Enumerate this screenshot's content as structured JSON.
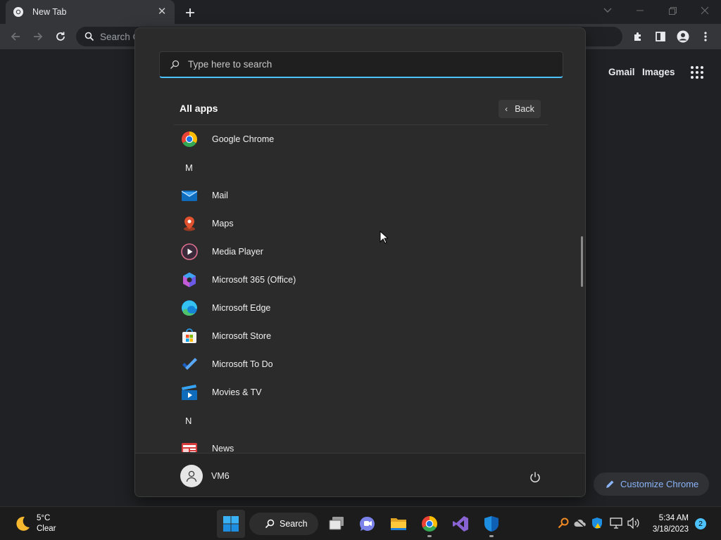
{
  "browser": {
    "tab_title": "New Tab",
    "omnibox_placeholder": "Search Google or type a URL",
    "omnibox_visible_text": "Search G",
    "links": {
      "gmail": "Gmail",
      "images": "Images"
    },
    "customize_label": "Customize Chrome"
  },
  "start_menu": {
    "search_placeholder": "Type here to search",
    "all_apps_title": "All apps",
    "back_label": "Back",
    "items": [
      {
        "kind": "app",
        "label": "Google Chrome",
        "icon": "chrome-icon"
      },
      {
        "kind": "letter",
        "label": "M"
      },
      {
        "kind": "app",
        "label": "Mail",
        "icon": "mail-icon"
      },
      {
        "kind": "app",
        "label": "Maps",
        "icon": "maps-icon"
      },
      {
        "kind": "app",
        "label": "Media Player",
        "icon": "media-player-icon"
      },
      {
        "kind": "app",
        "label": "Microsoft 365 (Office)",
        "icon": "office-icon"
      },
      {
        "kind": "app",
        "label": "Microsoft Edge",
        "icon": "edge-icon"
      },
      {
        "kind": "app",
        "label": "Microsoft Store",
        "icon": "store-icon"
      },
      {
        "kind": "app",
        "label": "Microsoft To Do",
        "icon": "todo-icon"
      },
      {
        "kind": "app",
        "label": "Movies & TV",
        "icon": "movies-icon"
      },
      {
        "kind": "letter",
        "label": "N"
      },
      {
        "kind": "app",
        "label": "News",
        "icon": "news-icon"
      }
    ],
    "user_name": "VM6"
  },
  "taskbar": {
    "weather_temp": "5°C",
    "weather_desc": "Clear",
    "search_label": "Search",
    "time": "5:34 AM",
    "date": "3/18/2023",
    "notification_count": "2"
  },
  "colors": {
    "accent": "#4cc2ff",
    "chrome_link": "#8ab4f8",
    "menu_bg": "#2b2b2b"
  }
}
